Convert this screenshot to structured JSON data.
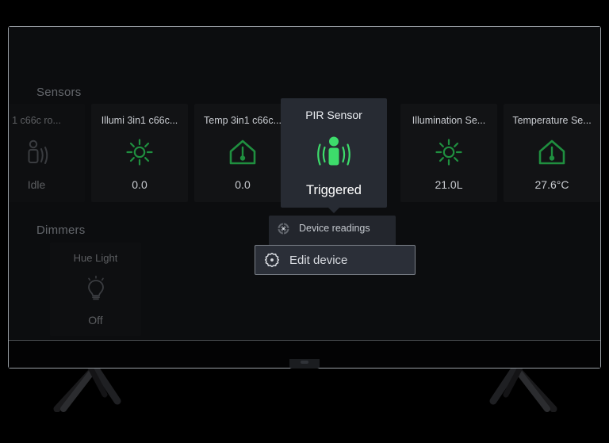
{
  "device": {
    "type": "television",
    "legs": "v-shaped-stand"
  },
  "dashboard": {
    "sections": [
      {
        "id": "sensors",
        "title": "Sensors"
      },
      {
        "id": "dimmers",
        "title": "Dimmers"
      }
    ]
  },
  "sensors": {
    "title": "Sensors",
    "cards": [
      {
        "name": "1 c66c ro...",
        "icon": "motion-sensor-icon",
        "value": "Idle",
        "state": "dimmed",
        "accent": "#6b6f74"
      },
      {
        "name": "Illumi 3in1 c66c...",
        "icon": "sun-brightness-icon",
        "value": "0.0",
        "state": "normal",
        "accent": "#1f8f3f"
      },
      {
        "name": "Temp 3in1 c66c...",
        "icon": "house-thermometer-icon",
        "value": "0.0",
        "state": "normal",
        "accent": "#1f8f3f"
      },
      {
        "name": "Illumination Se...",
        "icon": "sun-brightness-icon",
        "value": "21.0L",
        "state": "normal",
        "accent": "#1f8f3f"
      },
      {
        "name": "Temperature Se...",
        "icon": "house-thermometer-icon",
        "value": "27.6°C",
        "state": "normal",
        "accent": "#1f8f3f"
      }
    ]
  },
  "focused_card": {
    "name": "PIR Sensor",
    "icon": "motion-person-waves-icon",
    "value": "Triggered",
    "accent": "#3ddc6b",
    "background": "#272b33"
  },
  "context_menu": {
    "items": [
      {
        "label": "Device readings",
        "icon": "gauge-icon",
        "selected": false
      },
      {
        "label": "Edit device",
        "icon": "gear-icon",
        "selected": true
      }
    ],
    "highlight_border": "#7c8189"
  },
  "dimmers": {
    "title": "Dimmers",
    "cards": [
      {
        "name": "Hue Light",
        "icon": "lightbulb-icon",
        "value": "Off",
        "state": "dimmed",
        "accent": "#6b6f74"
      }
    ]
  },
  "colors": {
    "screen_background": "#0c0d0f",
    "card_background": "#121315",
    "menu_background": "#23262d",
    "green_accent": "#1f8f3f",
    "bright_green": "#3ddc6b",
    "text_primary": "#c9ccd1",
    "text_muted": "#63666b"
  }
}
